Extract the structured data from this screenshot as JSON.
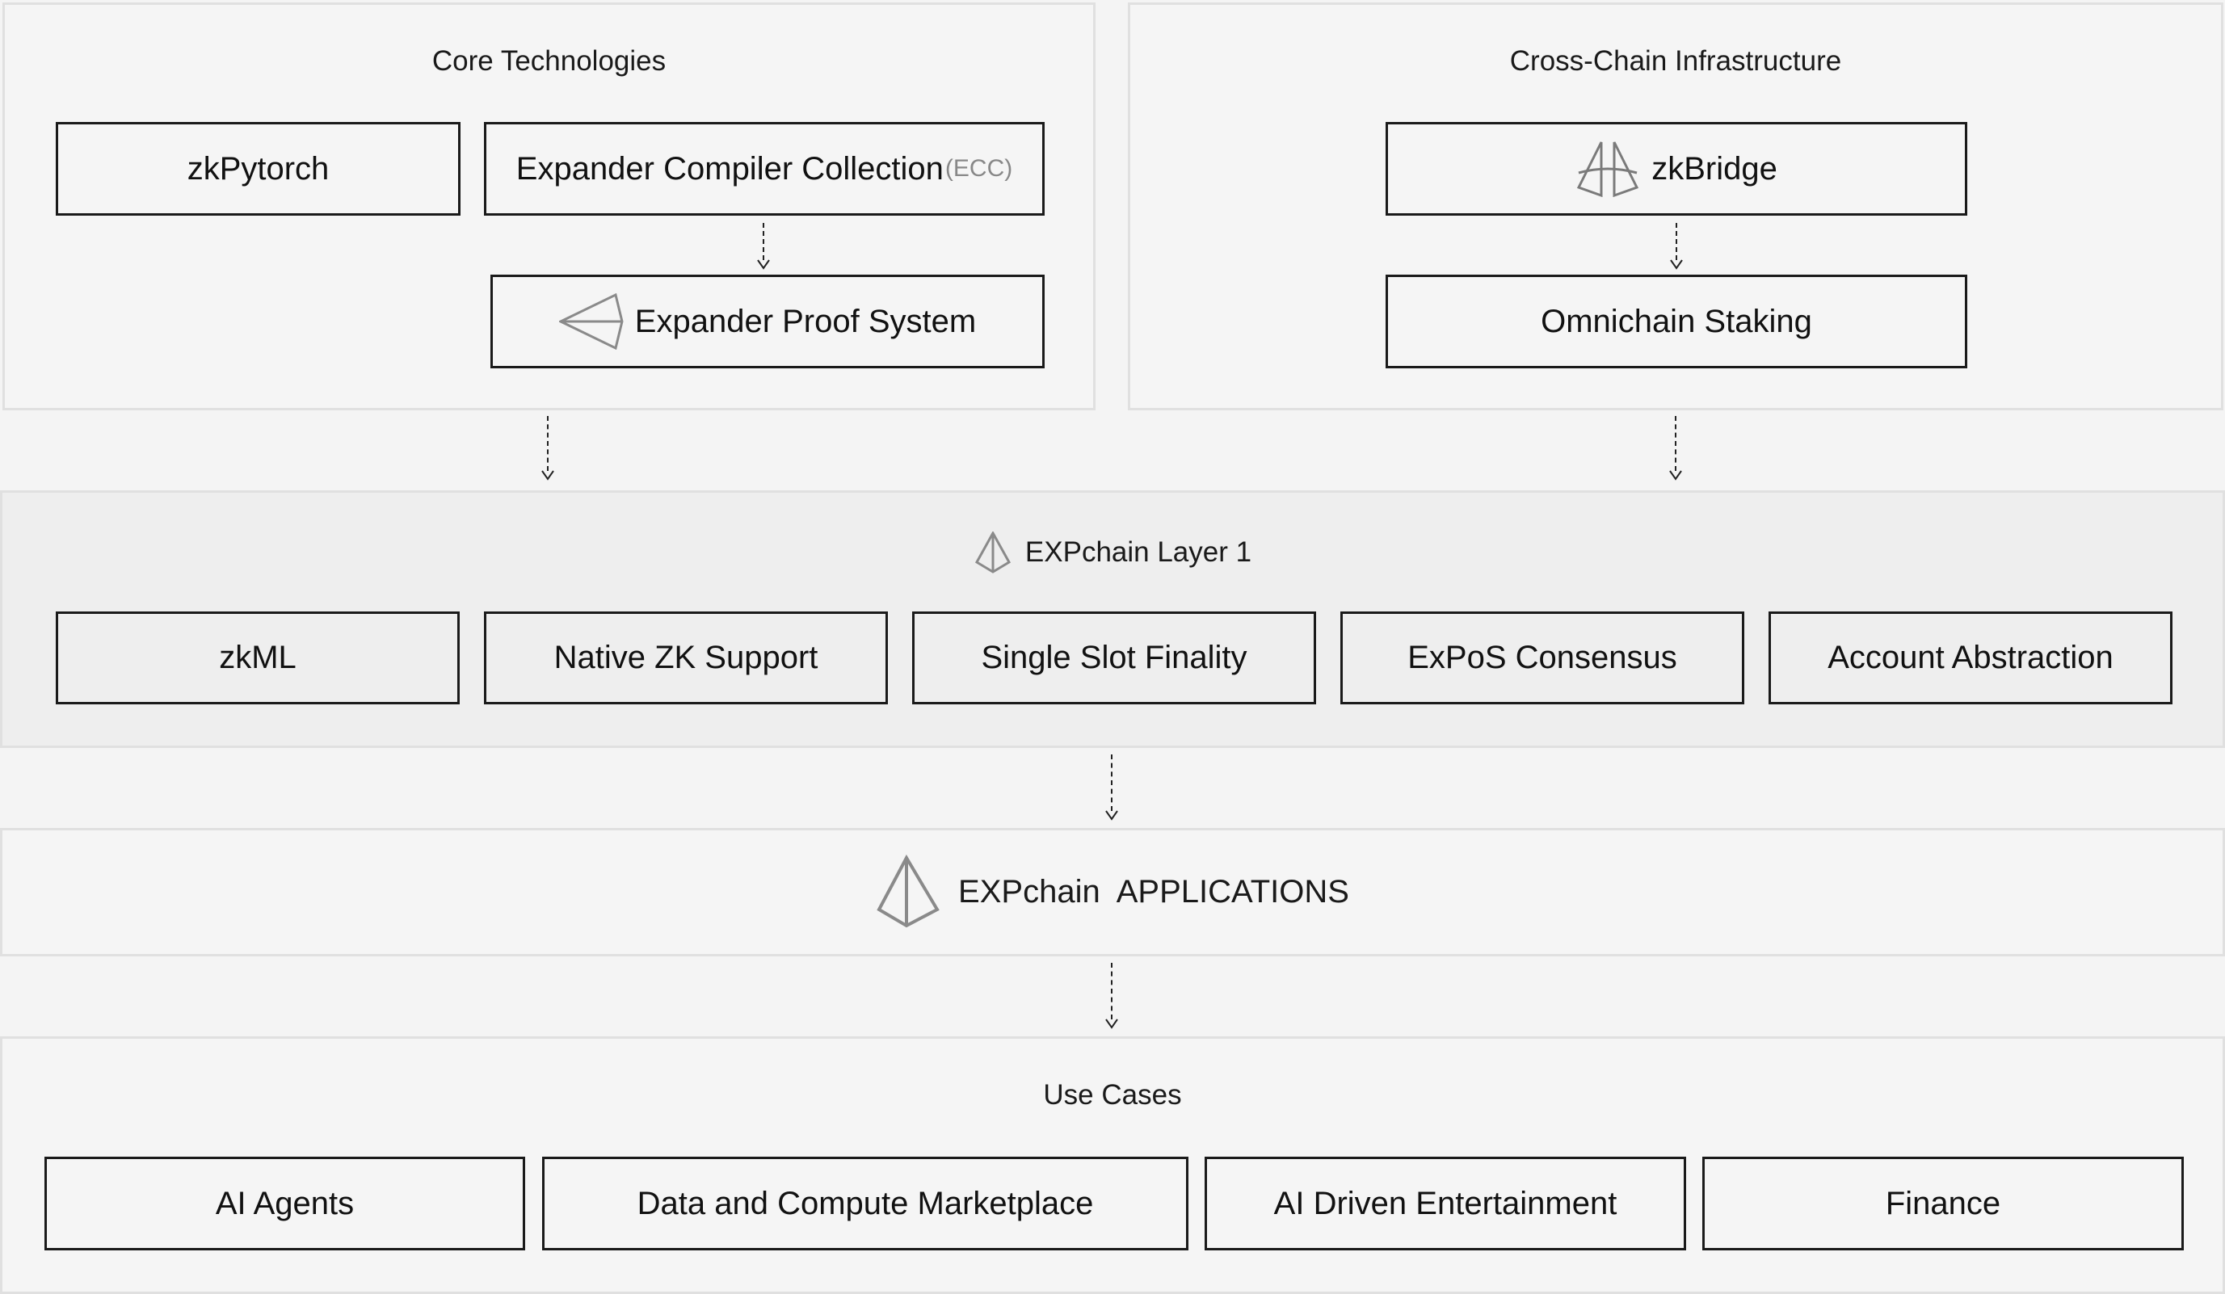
{
  "core": {
    "title": "Core Technologies",
    "boxes": [
      {
        "label": "zkPytorch"
      },
      {
        "label": "Expander Compiler Collection",
        "suffix": "(ECC)"
      },
      {
        "label": "Expander Proof System",
        "icon": "expander-logo-icon"
      }
    ]
  },
  "crosschain": {
    "title": "Cross-Chain Infrastructure",
    "boxes": [
      {
        "label": "zkBridge",
        "icon": "zkbridge-logo-icon"
      },
      {
        "label": "Omnichain Staking"
      }
    ]
  },
  "layer1": {
    "title": "EXPchain Layer 1",
    "icon": "expchain-logo-icon",
    "features": [
      {
        "label": "zkML"
      },
      {
        "label": "Native ZK Support"
      },
      {
        "label": "Single Slot Finality"
      },
      {
        "label": "ExPoS Consensus"
      },
      {
        "label": "Account Abstraction"
      }
    ]
  },
  "applications": {
    "title": "EXPchain  APPLICATIONS",
    "icon": "expchain-logo-icon"
  },
  "usecases": {
    "title": "Use Cases",
    "items": [
      {
        "label": "AI Agents"
      },
      {
        "label": "Data and Compute Marketplace"
      },
      {
        "label": "AI Driven Entertainment"
      },
      {
        "label": "Finance"
      }
    ]
  }
}
